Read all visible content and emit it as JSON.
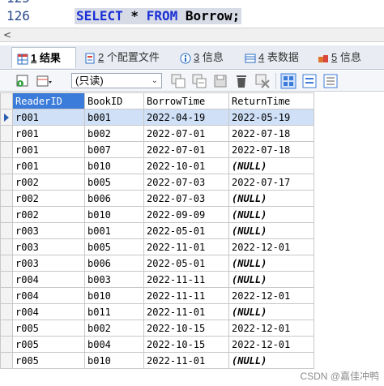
{
  "editor": {
    "line_prev_num": "125",
    "line_num": "126",
    "code_kw1": "SELECT",
    "code_star": " * ",
    "code_kw2": "FROM",
    "code_table": " Borrow;"
  },
  "tabs": [
    {
      "num": "1",
      "label": "结果"
    },
    {
      "num": "2",
      "label": "个配置文件"
    },
    {
      "num": "3",
      "label": "信息"
    },
    {
      "num": "4",
      "label": "表数据"
    },
    {
      "num": "5",
      "label": "信息"
    }
  ],
  "toolbar": {
    "mode_select": "(只读)"
  },
  "table": {
    "columns": [
      "ReaderID",
      "BookID",
      "BorrowTime",
      "ReturnTime"
    ],
    "rows": [
      [
        "r001",
        "b001",
        "2022-04-19",
        "2022-05-19"
      ],
      [
        "r001",
        "b002",
        "2022-07-01",
        "2022-07-18"
      ],
      [
        "r001",
        "b007",
        "2022-07-01",
        "2022-07-18"
      ],
      [
        "r001",
        "b010",
        "2022-10-01",
        "(NULL)"
      ],
      [
        "r002",
        "b005",
        "2022-07-03",
        "2022-07-17"
      ],
      [
        "r002",
        "b006",
        "2022-07-03",
        "(NULL)"
      ],
      [
        "r002",
        "b010",
        "2022-09-09",
        "(NULL)"
      ],
      [
        "r003",
        "b001",
        "2022-05-01",
        "(NULL)"
      ],
      [
        "r003",
        "b005",
        "2022-11-01",
        "2022-12-01"
      ],
      [
        "r003",
        "b006",
        "2022-05-01",
        "(NULL)"
      ],
      [
        "r004",
        "b003",
        "2022-11-11",
        "(NULL)"
      ],
      [
        "r004",
        "b010",
        "2022-11-11",
        "2022-12-01"
      ],
      [
        "r004",
        "b011",
        "2022-11-01",
        "(NULL)"
      ],
      [
        "r005",
        "b002",
        "2022-10-15",
        "2022-12-01"
      ],
      [
        "r005",
        "b004",
        "2022-10-15",
        "2022-12-01"
      ],
      [
        "r005",
        "b010",
        "2022-11-01",
        "(NULL)"
      ]
    ]
  },
  "watermark": "CSDN @嘉佳冲鸭",
  "colors": {
    "header_selected": "#3b7bd9",
    "current_row": "#cfe0f7",
    "keyword": "#1a2fd6"
  }
}
